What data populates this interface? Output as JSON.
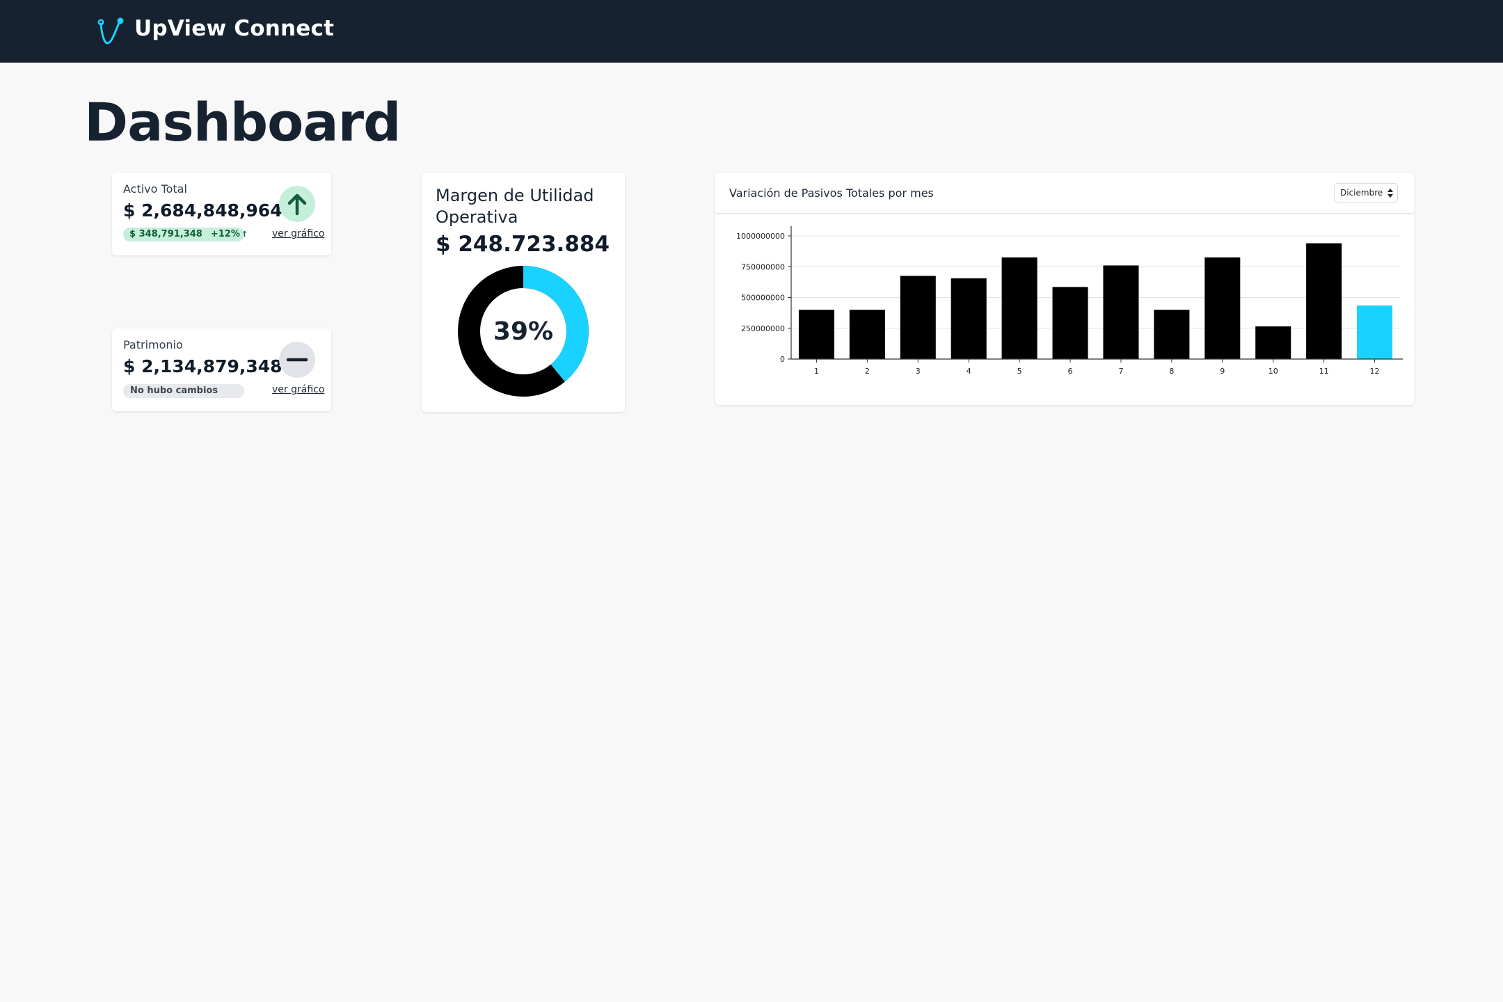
{
  "header": {
    "brand": "UpView Connect"
  },
  "page": {
    "title": "Dashboard"
  },
  "kpis": {
    "activo": {
      "label": "Activo Total",
      "value": "$ 2,684,848,964",
      "change_amount": "$ 348,791,348",
      "change_pct": "+12%",
      "change_arrow": "↑",
      "link": "ver gráfico",
      "trend_icon": "arrow-up-icon"
    },
    "patrimonio": {
      "label": "Patrimonio",
      "value": "$ 2,134,879,348",
      "status": "No hubo cambios",
      "link": "ver gráfico",
      "trend_icon": "minus-icon"
    }
  },
  "margin": {
    "title": "Margen de Utilidad Operativa",
    "value": "$ 248.723.884",
    "percent_label": "39%",
    "percent": 39
  },
  "liabilities": {
    "title": "Variación de Pasivos Totales por mes",
    "selected_month": "Diciembre"
  },
  "colors": {
    "accent": "#1ad2ff",
    "navbar": "#172231",
    "positive": "#c6efdb",
    "bar": "#000000"
  },
  "chart_data": {
    "type": "bar",
    "categories": [
      "1",
      "2",
      "3",
      "4",
      "5",
      "6",
      "7",
      "8",
      "9",
      "10",
      "11",
      "12"
    ],
    "values": [
      400000000,
      400000000,
      675000000,
      655000000,
      825000000,
      585000000,
      760000000,
      400000000,
      825000000,
      265000000,
      940000000,
      435000000
    ],
    "highlighted_category": "12",
    "title": "Variación de Pasivos Totales por mes",
    "xlabel": "",
    "ylabel": "",
    "ylim": [
      0,
      1000000000
    ],
    "yticks": [
      0,
      250000000,
      500000000,
      750000000,
      1000000000
    ],
    "grid": true
  }
}
